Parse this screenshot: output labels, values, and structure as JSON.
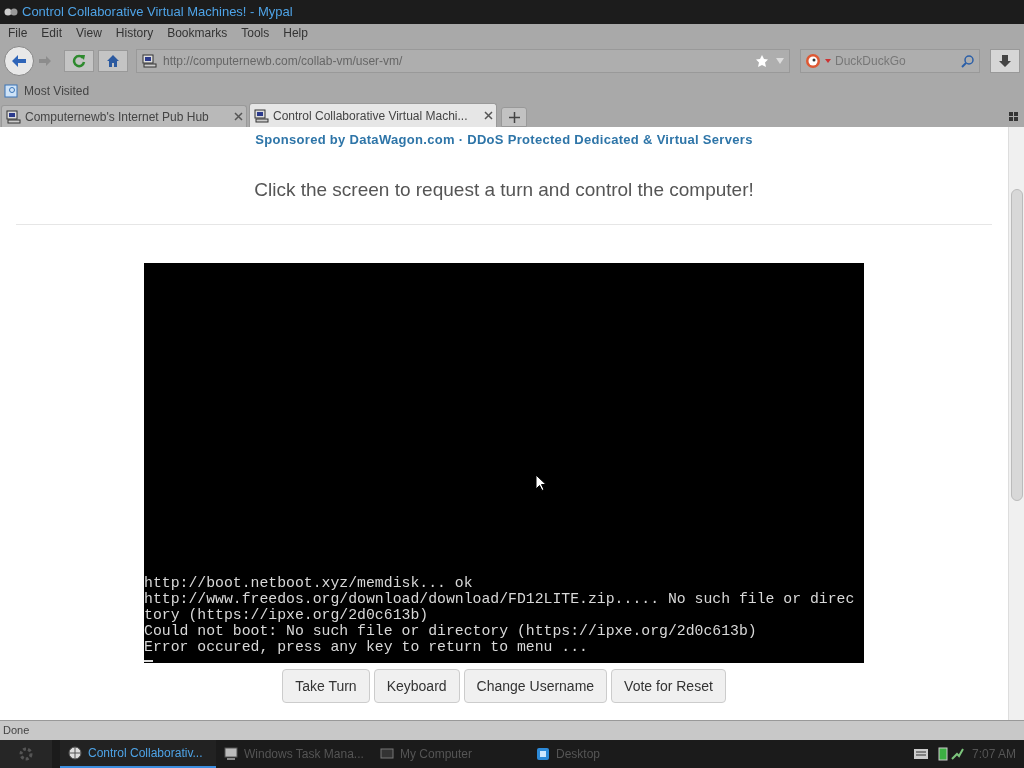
{
  "window": {
    "title": "Control Collaborative Virtual Machines! - Mypal"
  },
  "menu": [
    "File",
    "Edit",
    "View",
    "History",
    "Bookmarks",
    "Tools",
    "Help"
  ],
  "address_bar": {
    "url": "http://computernewb.com/collab-vm/user-vm/"
  },
  "search": {
    "placeholder": "DuckDuckGo"
  },
  "bookmarks": [
    "Most Visited"
  ],
  "tabs": [
    {
      "label": "Computernewb's Internet Pub Hub",
      "selected": false
    },
    {
      "label": "Control Collaborative Virtual Machi...",
      "selected": true
    }
  ],
  "page": {
    "sponsor": "Sponsored by DataWagon.com · DDoS Protected Dedicated & Virtual Servers",
    "headline": "Click the screen to request a turn and control the computer!",
    "terminal_lines": [
      "http://boot.netboot.xyz/memdisk... ok",
      "http://www.freedos.org/download/download/FD12LITE.zip..... No such file or direc",
      "tory (https://ipxe.org/2d0c613b)",
      "Could not boot: No such file or directory (https://ipxe.org/2d0c613b)",
      "Error occured, press any key to return to menu ..."
    ],
    "buttons": [
      "Take Turn",
      "Keyboard",
      "Change Username",
      "Vote for Reset"
    ]
  },
  "status_bar": "Done",
  "taskbar": {
    "items": [
      {
        "label": "Control Collaborativ...",
        "kind": "browser",
        "selected": true
      },
      {
        "label": "Windows Task Mana...",
        "kind": "monitor",
        "selected": false
      },
      {
        "label": "My Computer",
        "kind": "computer",
        "selected": false
      },
      {
        "label": "Desktop",
        "kind": "desktop",
        "selected": false
      }
    ],
    "clock": "7:07 AM"
  }
}
